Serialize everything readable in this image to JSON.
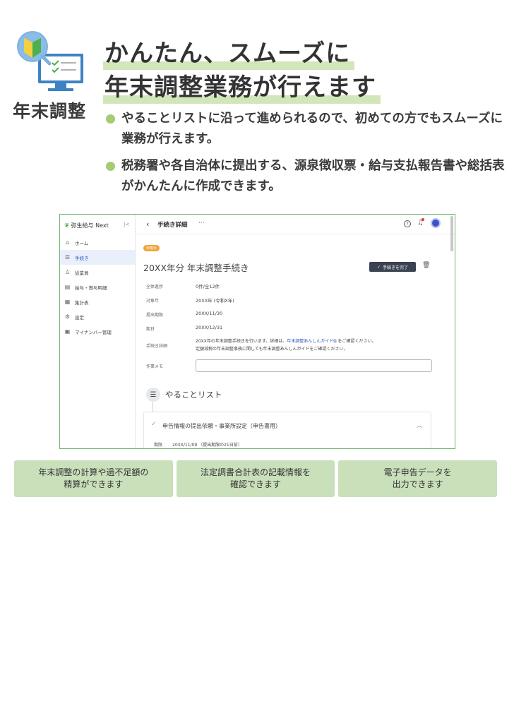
{
  "section": {
    "label": "年末調整"
  },
  "headline": {
    "line1": "かんたん、スムーズに",
    "line2": "年末調整業務が行えます"
  },
  "bullets": [
    "やることリストに沿って進められるので、初めての方でもスムーズに業務が行えます。",
    "税務署や各自治体に提出する、源泉徴収票・給与支払報告書や総括表がかんたんに作成できます。"
  ],
  "app": {
    "brand": "弥生給与 Next",
    "collapse": "|<",
    "nav": [
      {
        "icon": "home-icon",
        "label": "ホーム"
      },
      {
        "icon": "procedure-icon",
        "label": "手続き"
      },
      {
        "icon": "employee-icon",
        "label": "従業員"
      },
      {
        "icon": "document-icon",
        "label": "給与・賞与明細"
      },
      {
        "icon": "calendar-icon",
        "label": "集計表"
      },
      {
        "icon": "settings-icon",
        "label": "設定"
      },
      {
        "icon": "card-icon",
        "label": "マイナンバー管理"
      }
    ],
    "page_title": "手続き詳細",
    "more": "···",
    "status_tag": "未着手",
    "proc_title": "20XX年分 年末調整手続き",
    "complete_button": "手続きを完了",
    "fields": [
      {
        "label": "全体進捗",
        "value": "0件/全12件"
      },
      {
        "label": "対象年",
        "value": "20XX年 (令和X年)"
      },
      {
        "label": "提出期限",
        "value": "20XX/11/30"
      },
      {
        "label": "期日",
        "value": "20XX/12/31"
      }
    ],
    "detail": {
      "label": "手続き詳細",
      "text1": "20XX年の年末調整手続きを行います。詳細は、",
      "link": "年末調整あんしんガイド",
      "text2": " をご確認ください。",
      "text3": "定額減税の年末調整事務に関しても年末調整あんしんガイドをご確認ください。"
    },
    "memo_label": "作業メモ",
    "todo_title": "やることリスト",
    "card": {
      "title": "申告情報の提出依頼・事業所設定（申告書用）",
      "deadline_label": "期限",
      "deadline_value": "20XX/11/09 （提出期限の21日前）"
    }
  },
  "features": [
    "年末調整の計算や過不足額の\n精算ができます",
    "法定調書合計表の記載情報を\n確認できます",
    "電子申告データを\n出力できます"
  ],
  "colors": {
    "accent_green": "#a3cc73",
    "highlight": "#d2e7b9",
    "feature_bg": "#c9e0bb",
    "frame": "#6db56d"
  }
}
